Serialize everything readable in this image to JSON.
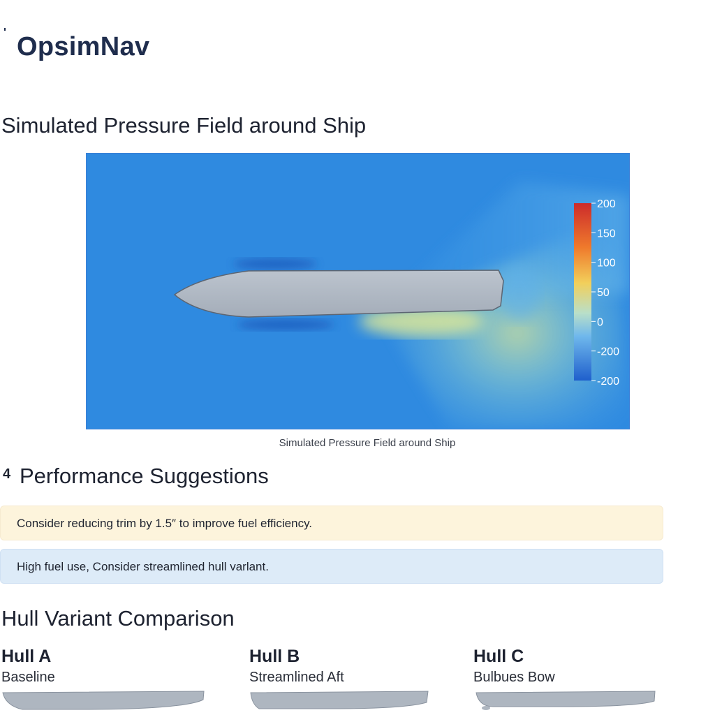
{
  "app": {
    "name": "OpsimNav"
  },
  "pressure_section": {
    "title": "Simulated Pressure Field around Ship",
    "caption": "Simulated Pressure Field around Ship",
    "colorbar_ticks": [
      "200",
      "150",
      "100",
      "50",
      "0",
      "-200",
      "-200"
    ],
    "colors": {
      "background": "#2f8ae0",
      "high": "#d7382b",
      "mid": "#f2c84b",
      "low": "#1e60c9",
      "hull": "#aab3bf"
    }
  },
  "suggestions": {
    "count": "4",
    "title": "Performance Suggestions",
    "items": [
      {
        "type": "warning",
        "text": "Consider reducing trim by 1.5″ to improve fuel efficiency."
      },
      {
        "type": "info",
        "text": "High fuel use, Consider streamlined hull varlant."
      }
    ]
  },
  "hull_comparison": {
    "title": "Hull Variant Comparison",
    "variants": [
      {
        "name": "Hull A",
        "subtitle": "Baseline"
      },
      {
        "name": "Hull B",
        "subtitle": "Streamlined Aft"
      },
      {
        "name": "Hull C",
        "subtitle": "Bulbues Bow"
      }
    ]
  }
}
